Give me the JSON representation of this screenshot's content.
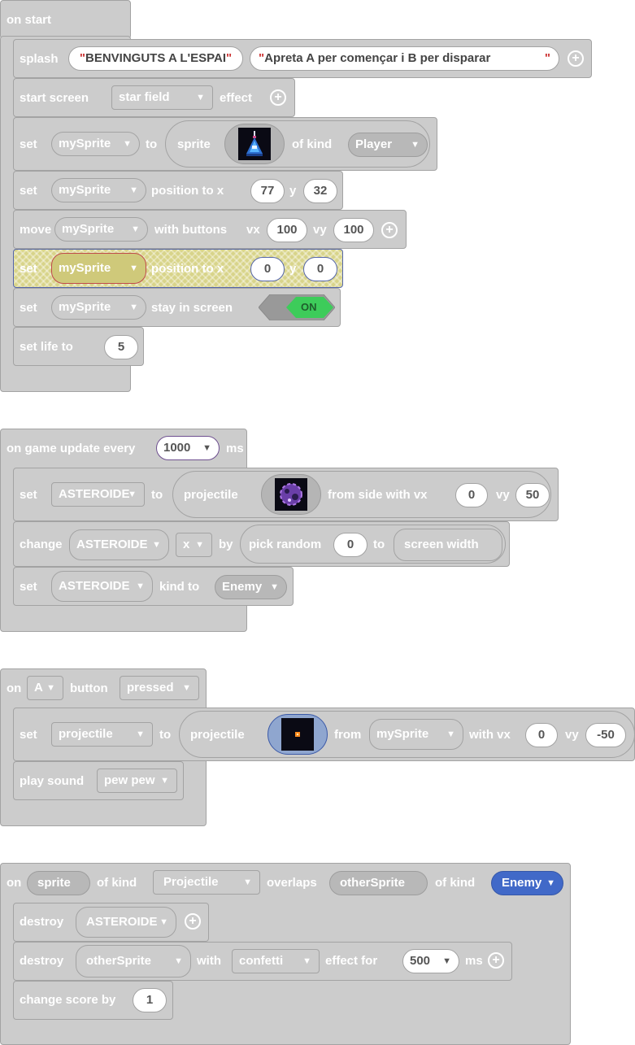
{
  "on_start": {
    "header": "on start",
    "splash": {
      "label": "splash",
      "title": "BENVINGUTS A L'ESPAI",
      "subtitle": "Apreta A per començar i B per disparar",
      "quote": "\""
    },
    "start_screen": {
      "label": "start screen",
      "effect": "star field",
      "suffix": "effect"
    },
    "set_sprite": {
      "label": "set",
      "var": "mySprite",
      "to": "to",
      "sprite": "sprite",
      "of_kind": "of kind",
      "kind": "Player"
    },
    "set_position": {
      "label": "set",
      "var": "mySprite",
      "pos_label": "position to x",
      "x": "77",
      "y_label": "y",
      "y": "32"
    },
    "move": {
      "label": "move",
      "var": "mySprite",
      "with_buttons": "with buttons",
      "vx_label": "vx",
      "vx": "100",
      "vy_label": "vy",
      "vy": "100"
    },
    "set_position2": {
      "label": "set",
      "var": "mySprite",
      "pos_label": "position to x",
      "x": "0",
      "y_label": "y",
      "y": "0"
    },
    "stay": {
      "label": "set",
      "var": "mySprite",
      "stay_label": "stay in screen",
      "toggle": "ON"
    },
    "life": {
      "label": "set life to",
      "value": "5"
    }
  },
  "on_update": {
    "header": "on game update every",
    "interval": "1000",
    "ms": "ms",
    "set_proj": {
      "label": "set",
      "var": "ASTEROIDE",
      "to": "to",
      "projectile": "projectile",
      "from_side": "from side with vx",
      "vx": "0",
      "vy_label": "vy",
      "vy": "50"
    },
    "change": {
      "label": "change",
      "var": "ASTEROIDE",
      "prop": "x",
      "by": "by",
      "pick": "pick random",
      "from": "0",
      "to": "to",
      "max": "screen width"
    },
    "set_kind": {
      "label": "set",
      "var": "ASTEROIDE",
      "kind_to": "kind to",
      "kind": "Enemy"
    }
  },
  "on_button": {
    "on": "on",
    "button": "A",
    "button_label": "button",
    "event": "pressed",
    "set_proj": {
      "label": "set",
      "var": "projectile",
      "to": "to",
      "projectile": "projectile",
      "from": "from",
      "source": "mySprite",
      "with_vx": "with vx",
      "vx": "0",
      "vy_label": "vy",
      "vy": "-50"
    },
    "play": {
      "label": "play sound",
      "sound": "pew pew"
    }
  },
  "on_overlap": {
    "on": "on",
    "sprite": "sprite",
    "of_kind": "of kind",
    "kind1": "Projectile",
    "overlaps": "overlaps",
    "other": "otherSprite",
    "of_kind2": "of kind",
    "kind2": "Enemy",
    "destroy1": {
      "label": "destroy",
      "var": "ASTEROIDE"
    },
    "destroy2": {
      "label": "destroy",
      "var": "otherSprite",
      "with": "with",
      "effect": "confetti",
      "effect_for": "effect for",
      "ms_value": "500",
      "ms": "ms"
    },
    "score": {
      "label": "change score by",
      "value": "1"
    }
  },
  "colors": {
    "block": "#cccccc",
    "border": "#a3a3a3",
    "toggle_on": "#3dcc5a",
    "enemy_kind": "#4169c8"
  }
}
